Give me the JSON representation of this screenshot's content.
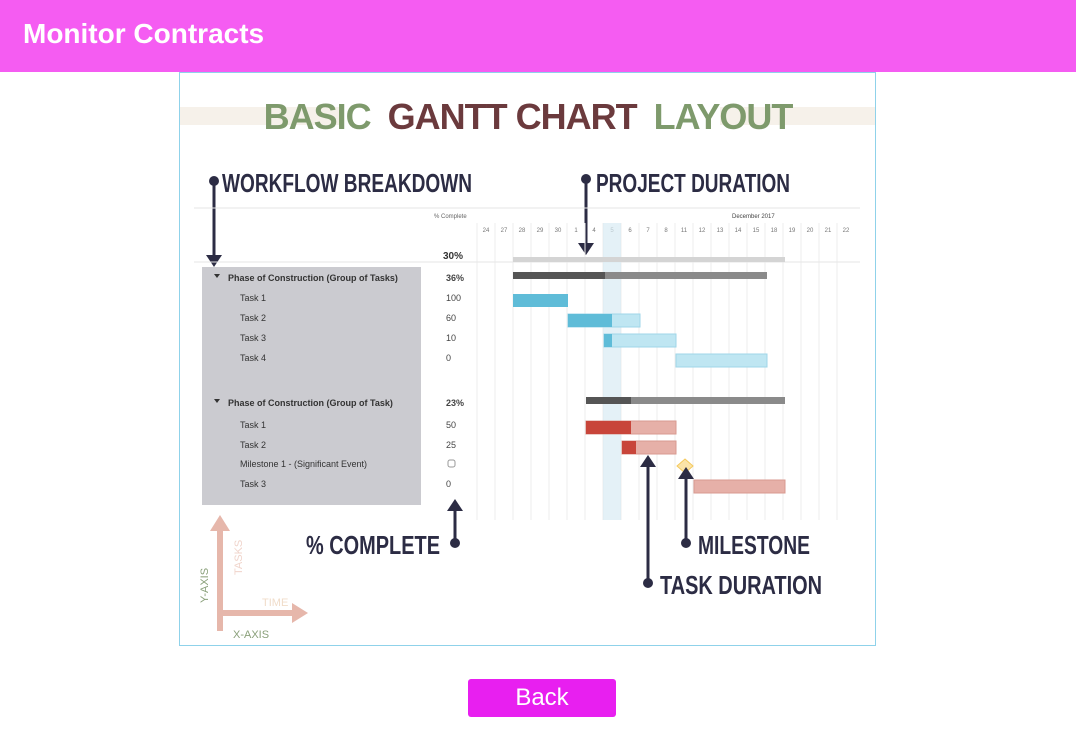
{
  "header": {
    "title": "Monitor Contracts"
  },
  "infographic": {
    "title_part1": "BASIC",
    "title_part2": "GANTT CHART",
    "title_part3": "LAYOUT",
    "callout_workflow": "WORKFLOW BREAKDOWN",
    "callout_duration": "PROJECT DURATION",
    "callout_complete": "% COMPLETE",
    "callout_milestone": "MILESTONE",
    "callout_task_duration": "TASK DURATION",
    "axis_tasks": "TASKS",
    "axis_y": "Y-AXIS",
    "axis_time": "TIME",
    "axis_x": "X-AXIS",
    "col_complete_header": "% Complete",
    "month_label": "December 2017",
    "days": [
      "24",
      "27",
      "28",
      "29",
      "30",
      "1",
      "4",
      "5",
      "6",
      "7",
      "8",
      "11",
      "12",
      "13",
      "14",
      "15",
      "18",
      "19",
      "20",
      "21",
      "22"
    ],
    "overall_percent": "30%",
    "rows": [
      {
        "label": "Phase of Construction (Group of Tasks)",
        "pct": "36%",
        "group": true
      },
      {
        "label": "Task 1",
        "pct": "100",
        "group": false
      },
      {
        "label": "Task 2",
        "pct": "60",
        "group": false
      },
      {
        "label": "Task 3",
        "pct": "10",
        "group": false
      },
      {
        "label": "Task 4",
        "pct": "0",
        "group": false
      },
      {
        "label": "Phase of Construction (Group of Task)",
        "pct": "23%",
        "group": true
      },
      {
        "label": "Task 1",
        "pct": "50",
        "group": false
      },
      {
        "label": "Task 2",
        "pct": "25",
        "group": false
      },
      {
        "label": "Milestone 1 - (Significant Event)",
        "pct": "",
        "group": false
      },
      {
        "label": "Task 3",
        "pct": "0",
        "group": false
      }
    ],
    "colors": {
      "title_green": "#7e9a6c",
      "title_maroon": "#6b3a3d",
      "arrow": "#2c2c44",
      "blue_done": "#5fbcd8",
      "blue_todo": "#bfe6f2",
      "red_done": "#c8453a",
      "red_todo": "#e6b0a8",
      "milestone": "#f5c95c"
    }
  },
  "back_button": {
    "label": "Back"
  }
}
